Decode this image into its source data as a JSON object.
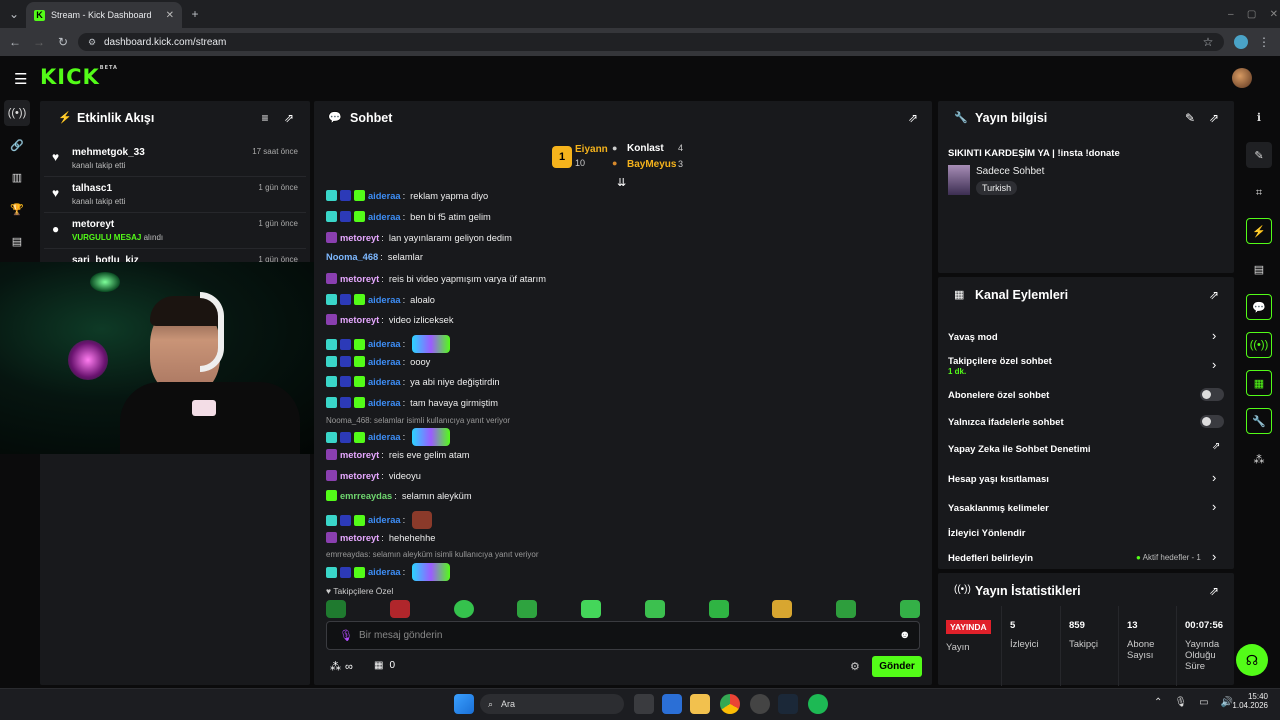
{
  "browser": {
    "tab_title": "Stream - Kick Dashboard",
    "url": "dashboard.kick.com/stream"
  },
  "header": {
    "logo": "KICK",
    "logo_badge": "BETA"
  },
  "activity": {
    "title": "Etkinlik Akışı",
    "items": [
      {
        "name": "mehmetgok_33",
        "sub": "kanalı takip etti",
        "time": "17 saat önce"
      },
      {
        "name": "talhasc1",
        "sub": "kanalı takip etti",
        "time": "1 gün önce"
      },
      {
        "name": "metoreyt",
        "sub_hl": "VURGULU MESAJ",
        "sub": "alındı",
        "time": "1 gün önce"
      },
      {
        "name": "sari_botlu_kiz",
        "sub": "",
        "time": "1 gün önce"
      }
    ]
  },
  "chat": {
    "title": "Sohbet",
    "leaderboard": {
      "first": {
        "name": "Eiyann",
        "count": "10"
      },
      "second": {
        "name": "Konlast",
        "count": "4"
      },
      "third": {
        "name": "BayMeyus",
        "count": "3"
      }
    },
    "messages": [
      {
        "user": "aideraa",
        "text": "reklam yapma diyo",
        "color": "#3d8df5"
      },
      {
        "user": "aideraa",
        "text": "ben bi f5 atim gelim",
        "color": "#3d8df5"
      },
      {
        "user": "metoreyt",
        "text": "lan yayınlaramı geliyon dedim",
        "color": "#e6a8ff"
      },
      {
        "user": "Nooma_468",
        "text": "selamlar",
        "color": "#7db8ff"
      },
      {
        "user": "metoreyt",
        "text": "reis bi video yapmışım varya üf atarım",
        "color": "#e6a8ff"
      },
      {
        "user": "aideraa",
        "text": "aloalo",
        "color": "#3d8df5"
      },
      {
        "user": "metoreyt",
        "text": "video izliceksek",
        "color": "#e6a8ff"
      },
      {
        "user": "aideraa",
        "text": "",
        "color": "#3d8df5"
      },
      {
        "user": "aideraa",
        "text": "oooy",
        "color": "#3d8df5"
      },
      {
        "user": "aideraa",
        "text": "ya abi niye değiştirdin",
        "color": "#3d8df5"
      },
      {
        "user": "aideraa",
        "text": "tam havaya girmiştim",
        "color": "#3d8df5"
      },
      {
        "user": "aideraa",
        "text": "",
        "color": "#3d8df5"
      },
      {
        "user": "metoreyt",
        "text": "reis eve gelim atam",
        "color": "#e6a8ff"
      },
      {
        "user": "metoreyt",
        "text": "videoyu",
        "color": "#e6a8ff"
      },
      {
        "user": "emrreaydas",
        "text": "selamın aleyküm",
        "color": "#6fd66f"
      },
      {
        "user": "aideraa",
        "text": "",
        "color": "#3d8df5"
      },
      {
        "user": "metoreyt",
        "text": "hehehehhe",
        "color": "#e6a8ff"
      },
      {
        "user": "aideraa",
        "text": "",
        "color": "#3d8df5"
      }
    ],
    "reply1": "Nooma_468: selamlar isimli kullanıcıya yanıt veriyor",
    "reply2": "emrreaydas: selamın aleyküm isimli kullanıcıya yanıt veriyor",
    "emote_label": "Takipçilere Özel",
    "input_placeholder": "Bir mesaj gönderin",
    "points": "∞",
    "gifts": "0",
    "send": "Gönder"
  },
  "stream_info": {
    "title": "Yayın bilgisi",
    "stream_title": "SIKINTI KARDEŞİM YA | !insta !donate",
    "category": "Sadece Sohbet",
    "tag": "Turkish"
  },
  "channel_actions": {
    "title": "Kanal Eylemleri",
    "items": {
      "slow": "Yavaş mod",
      "followers": "Takipçilere özel sohbet",
      "followers_sub": "1 dk.",
      "subs": "Abonelere özel sohbet",
      "emotes": "Yalnızca ifadelerle sohbet",
      "ai": "Yapay Zeka ile Sohbet Denetimi",
      "age": "Hesap yaşı kısıtlaması",
      "banned": "Yasaklanmış kelimeler",
      "viewer": "İzleyici Yönlendir",
      "goals": "Hedefleri belirleyin",
      "goals_status": "Aktif hedefler - 1"
    }
  },
  "stats": {
    "title": "Yayın İstatistikleri",
    "live": "YAYINDA",
    "live_label": "Yayın",
    "viewers": "5",
    "viewers_label": "İzleyici",
    "followers": "859",
    "followers_label": "Takipçi",
    "subs": "13",
    "subs_label": "Abone Sayısı",
    "uptime": "00:07:56",
    "uptime_label": "Yayında Olduğu Süre"
  },
  "taskbar": {
    "search": "Ara",
    "time": "15:40",
    "date": "1.04.2026"
  },
  "colors": {
    "accent": "#53fc18",
    "panel": "#18191c",
    "live": "#e0202a"
  }
}
